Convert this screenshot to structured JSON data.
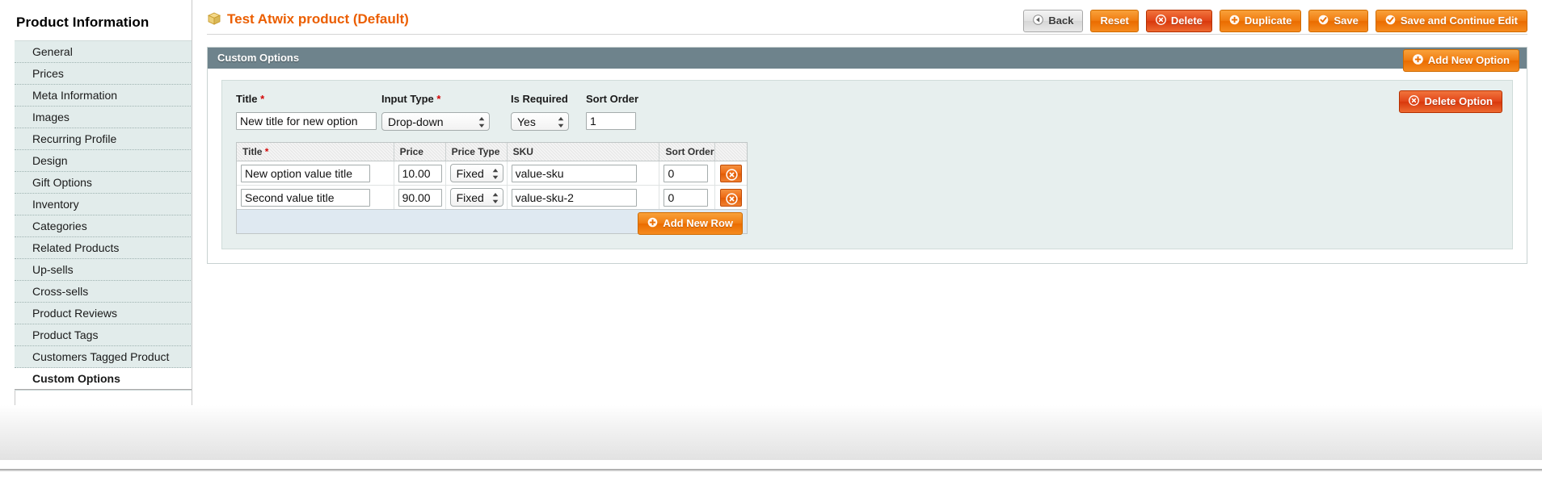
{
  "sidebar": {
    "title": "Product Information",
    "items": [
      {
        "label": "General",
        "active": false
      },
      {
        "label": "Prices",
        "active": false
      },
      {
        "label": "Meta Information",
        "active": false
      },
      {
        "label": "Images",
        "active": false
      },
      {
        "label": "Recurring Profile",
        "active": false
      },
      {
        "label": "Design",
        "active": false
      },
      {
        "label": "Gift Options",
        "active": false
      },
      {
        "label": "Inventory",
        "active": false
      },
      {
        "label": "Categories",
        "active": false
      },
      {
        "label": "Related Products",
        "active": false
      },
      {
        "label": "Up-sells",
        "active": false
      },
      {
        "label": "Cross-sells",
        "active": false
      },
      {
        "label": "Product Reviews",
        "active": false
      },
      {
        "label": "Product Tags",
        "active": false
      },
      {
        "label": "Customers Tagged Product",
        "active": false
      },
      {
        "label": "Custom Options",
        "active": true
      }
    ]
  },
  "header": {
    "title": "Test Atwix product (Default)",
    "title_icon": "package-box-icon",
    "buttons": [
      {
        "label": "Back",
        "style": "grey",
        "icon": "back-arrow-icon"
      },
      {
        "label": "Reset",
        "style": "orange",
        "icon": "none"
      },
      {
        "label": "Delete",
        "style": "red",
        "icon": "x-circle-icon"
      },
      {
        "label": "Duplicate",
        "style": "orange",
        "icon": "plus-circle-icon"
      },
      {
        "label": "Save",
        "style": "orange",
        "icon": "check-circle-icon"
      },
      {
        "label": "Save and Continue Edit",
        "style": "orange",
        "icon": "check-circle-icon"
      }
    ]
  },
  "panel": {
    "title": "Custom Options",
    "add_option_button": {
      "label": "Add New Option",
      "icon": "plus-circle-icon"
    },
    "delete_option_button": {
      "label": "Delete Option",
      "icon": "x-circle-icon"
    }
  },
  "option": {
    "fields": [
      {
        "label": "Title",
        "required": true,
        "type": "text",
        "value": "New title for new option"
      },
      {
        "label": "Input Type",
        "required": true,
        "type": "select",
        "value": "Drop-down"
      },
      {
        "label": "Is Required",
        "required": false,
        "type": "select",
        "value": "Yes"
      },
      {
        "label": "Sort Order",
        "required": false,
        "type": "text",
        "value": "1"
      }
    ],
    "values_table": {
      "columns": [
        {
          "label": "Title",
          "required": true
        },
        {
          "label": "Price",
          "required": false
        },
        {
          "label": "Price Type",
          "required": false
        },
        {
          "label": "SKU",
          "required": false
        },
        {
          "label": "Sort Order",
          "required": false
        },
        {
          "label": "",
          "required": false
        }
      ],
      "rows": [
        {
          "title": "New option value title",
          "price": "10.00",
          "price_type": "Fixed",
          "sku": "value-sku",
          "sort_order": "0",
          "delete_icon": "x-circle-icon"
        },
        {
          "title": "Second value title",
          "price": "90.00",
          "price_type": "Fixed",
          "sku": "value-sku-2",
          "sort_order": "0",
          "delete_icon": "x-circle-icon"
        }
      ],
      "add_row_button": {
        "label": "Add New Row",
        "icon": "plus-circle-icon"
      }
    }
  },
  "colors": {
    "accent_orange": "#eb5e00",
    "panel_header": "#6e838c",
    "sidebar_bg": "#e2eceb",
    "option_bg": "#e7efee",
    "delete_red": "#d8380c",
    "required_star": "#d40707"
  }
}
